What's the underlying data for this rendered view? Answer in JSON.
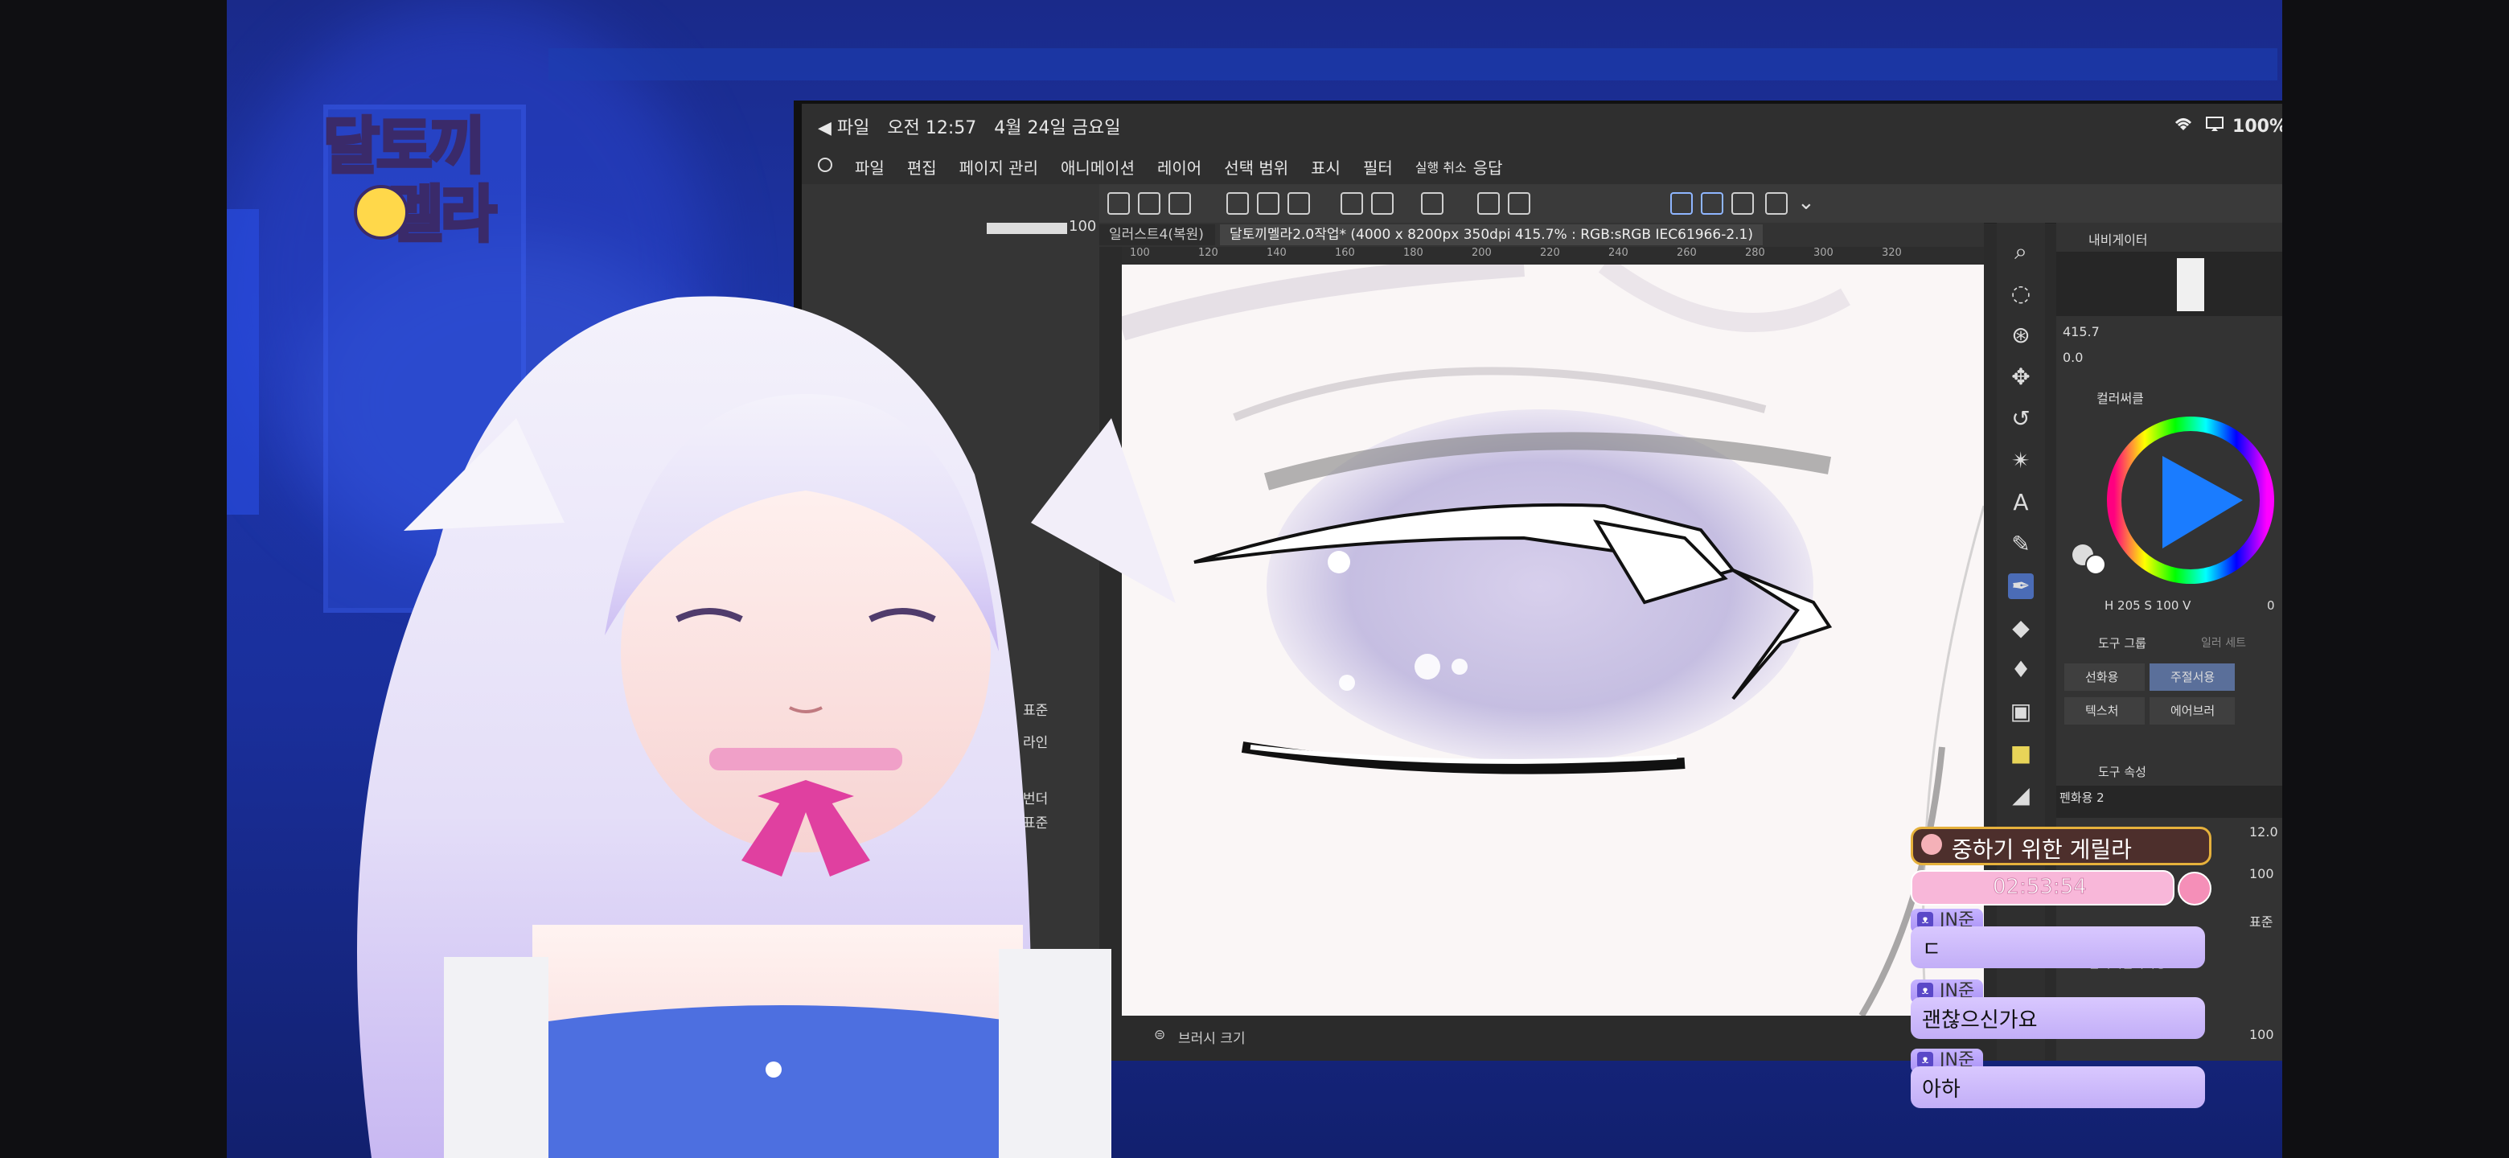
{
  "status": {
    "back_label": "◀ 파일",
    "time": "오전 12:57",
    "date": "4월 24일 금요일",
    "battery": "100%"
  },
  "menu": [
    "파일",
    "편집",
    "페이지 관리",
    "애니메이션",
    "레이어",
    "선택 범위",
    "표시",
    "필터"
  ],
  "menu_extra": {
    "undo_hint": "실행 취소",
    "ok": "응답"
  },
  "tabs": {
    "inactive": "일러스트4(복원)",
    "active": "달토끼멜라2.0작업* (4000 x 8200px 350dpi 415.7% : RGB:sRGB IEC61966-2.1)"
  },
  "ruler": [
    "100",
    "120",
    "140",
    "160",
    "180",
    "200",
    "220",
    "240",
    "260",
    "280",
    "300",
    "320"
  ],
  "leftpanel": {
    "opacity": "100",
    "labels": [
      "표준",
      "라인",
      "번더",
      "표준"
    ]
  },
  "navigator": {
    "title": "내비게이터",
    "zoom": "415.7",
    "angle": "0.0"
  },
  "color": {
    "title": "컬러써클",
    "values": "H 205 S 100 V",
    "v_value": "0"
  },
  "toolgroup": {
    "title": "도구 그룹",
    "other": "일러 세트",
    "row1": [
      "선화용",
      "주절서용"
    ],
    "row2": [
      "텍스처",
      "에어브러"
    ]
  },
  "toolprops": {
    "title": "도구 속성",
    "brush": "펜화용 2",
    "size": "12.0",
    "opacity": "100",
    "blend": "표준",
    "aa_label": "안티에일리어싱",
    "last": "100"
  },
  "bottom": {
    "brush_size": "브러시 크기"
  },
  "overlay": {
    "logo_line1": "달토끼",
    "logo_line2": "멜라",
    "banner": "중하기 위한 게릴라",
    "timer": "02:53:54"
  },
  "chat": [
    {
      "user": "JN준",
      "text": "ㄷ"
    },
    {
      "user": "JN준",
      "text": "괜찮으신가요"
    },
    {
      "user": "JN준",
      "text": "아하"
    }
  ],
  "colors": {
    "accent": "#7d6cf5",
    "banner_border": "#e6b13c",
    "chat_bg": "#c9b6fb"
  }
}
